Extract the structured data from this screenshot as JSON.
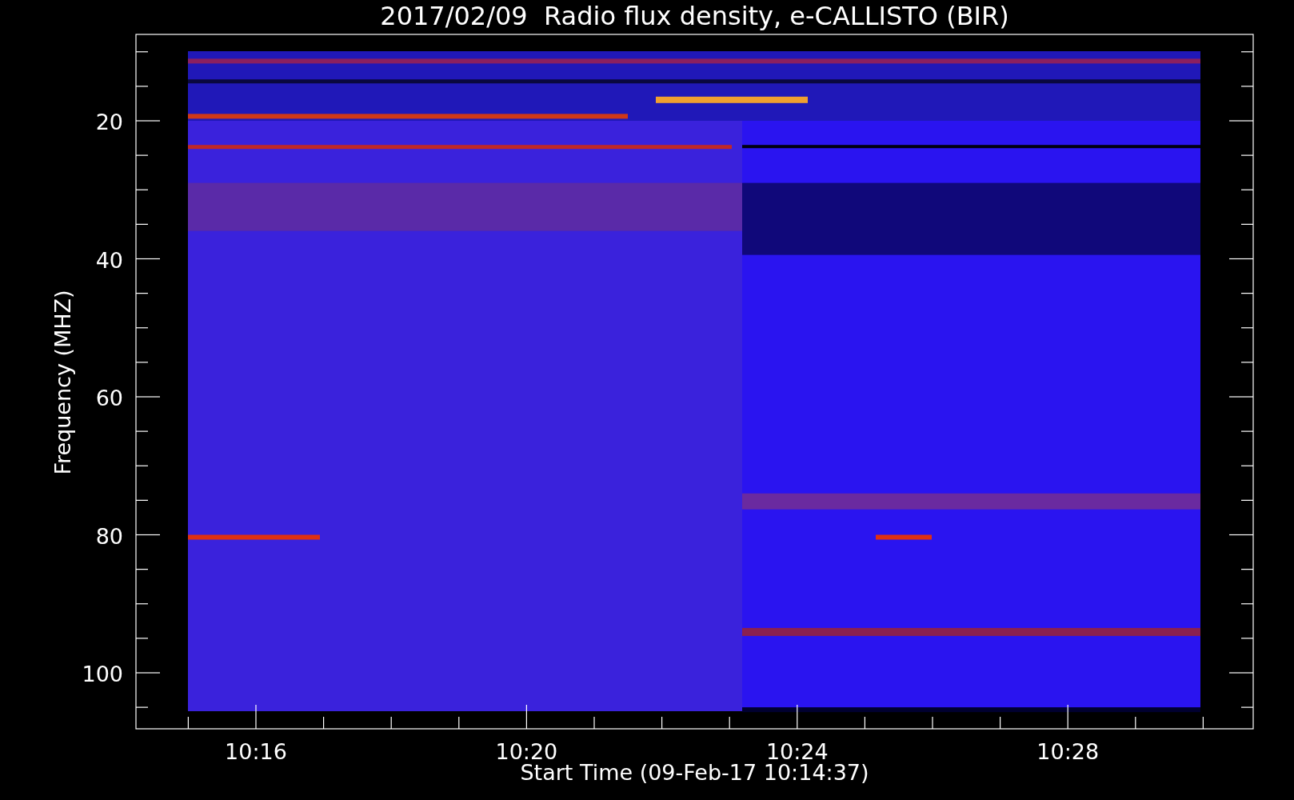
{
  "plot": {
    "title": "2017/02/09  Radio flux density, e-CALLISTO (BIR)",
    "ylabel": "Frequency (MHZ)",
    "xlabel": "Start Time (09-Feb-17 10:14:37)",
    "y_ticks": [
      "20",
      "40",
      "60",
      "80",
      "100"
    ],
    "x_ticks": [
      "10:16",
      "10:20",
      "10:24",
      "10:28"
    ]
  }
}
